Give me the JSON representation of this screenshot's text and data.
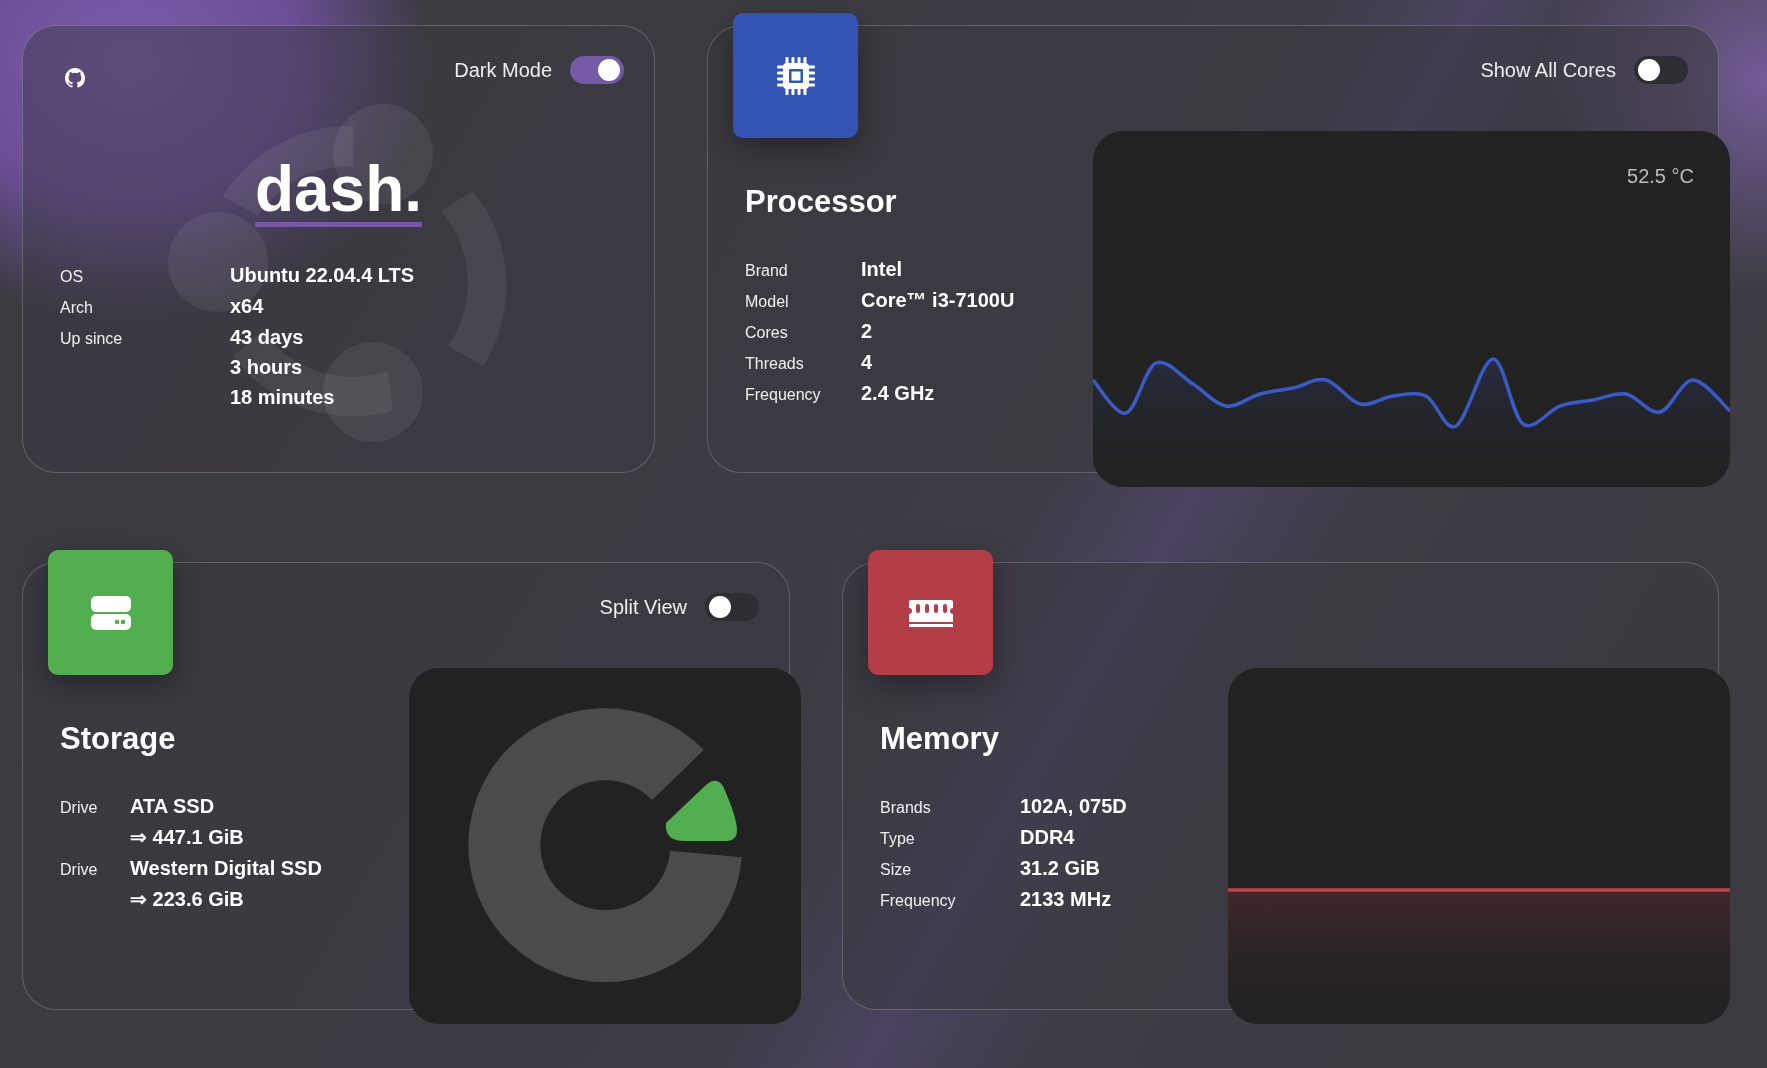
{
  "header": {
    "title": "dash.",
    "toggle": {
      "label": "Dark Mode",
      "on": true
    }
  },
  "system": [
    {
      "label": "OS",
      "values": [
        "Ubuntu 22.04.4 LTS"
      ]
    },
    {
      "label": "Arch",
      "values": [
        "x64"
      ]
    },
    {
      "label": "Up since",
      "values": [
        "43 days",
        "3 hours",
        "18 minutes"
      ]
    }
  ],
  "widgets": [
    {
      "kind": "cpu",
      "title": "Processor",
      "color": "#3454b4",
      "toggle": {
        "label": "Show All Cores",
        "on": false
      },
      "temperature": "52.5 °C",
      "rows": [
        {
          "label": "Brand",
          "values": [
            "Intel"
          ]
        },
        {
          "label": "Model",
          "values": [
            "Core™ i3-7100U"
          ]
        },
        {
          "label": "Cores",
          "values": [
            "2"
          ]
        },
        {
          "label": "Threads",
          "values": [
            "4"
          ]
        },
        {
          "label": "Frequency",
          "values": [
            "2.4 GHz"
          ]
        }
      ]
    },
    {
      "kind": "storage",
      "title": "Storage",
      "color": "#52ae4f",
      "toggle": {
        "label": "Split View",
        "on": false
      },
      "rows": [
        {
          "label": "Drive",
          "values": [
            "ATA SSD",
            "⇒ 447.1 GiB"
          ]
        },
        {
          "label": "Drive",
          "values": [
            "Western Digital SSD",
            "⇒ 223.6 GiB"
          ]
        }
      ]
    },
    {
      "kind": "memory",
      "title": "Memory",
      "color": "#b43e47",
      "rows": [
        {
          "label": "Brands",
          "values": [
            "102A, 075D"
          ]
        },
        {
          "label": "Type",
          "values": [
            "DDR4"
          ]
        },
        {
          "label": "Size",
          "values": [
            "31.2 GiB"
          ]
        },
        {
          "label": "Frequency",
          "values": [
            "2133 MHz"
          ]
        }
      ]
    }
  ]
}
